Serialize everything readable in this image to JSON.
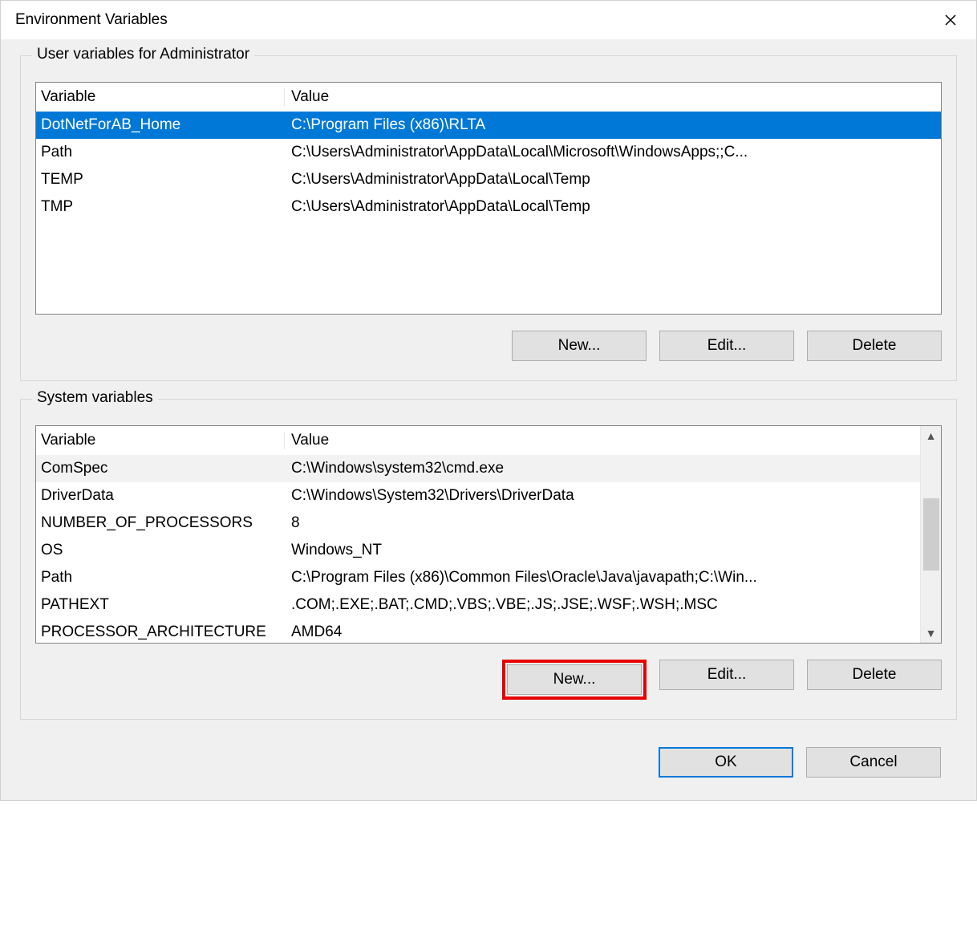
{
  "window": {
    "title": "Environment Variables"
  },
  "group_user": {
    "legend": "User variables for Administrator",
    "col_variable": "Variable",
    "col_value": "Value",
    "rows": [
      {
        "var": "DotNetForAB_Home",
        "val": "C:\\Program Files (x86)\\RLTA",
        "selected": true
      },
      {
        "var": "Path",
        "val": "C:\\Users\\Administrator\\AppData\\Local\\Microsoft\\WindowsApps;;C..."
      },
      {
        "var": "TEMP",
        "val": "C:\\Users\\Administrator\\AppData\\Local\\Temp"
      },
      {
        "var": "TMP",
        "val": "C:\\Users\\Administrator\\AppData\\Local\\Temp"
      }
    ],
    "btn_new": "New...",
    "btn_edit": "Edit...",
    "btn_delete": "Delete"
  },
  "group_system": {
    "legend": "System variables",
    "col_variable": "Variable",
    "col_value": "Value",
    "rows": [
      {
        "var": "ComSpec",
        "val": "C:\\Windows\\system32\\cmd.exe",
        "alt": true
      },
      {
        "var": "DriverData",
        "val": "C:\\Windows\\System32\\Drivers\\DriverData"
      },
      {
        "var": "NUMBER_OF_PROCESSORS",
        "val": "8"
      },
      {
        "var": "OS",
        "val": "Windows_NT"
      },
      {
        "var": "Path",
        "val": "C:\\Program Files (x86)\\Common Files\\Oracle\\Java\\javapath;C:\\Win..."
      },
      {
        "var": "PATHEXT",
        "val": ".COM;.EXE;.BAT;.CMD;.VBS;.VBE;.JS;.JSE;.WSF;.WSH;.MSC"
      },
      {
        "var": "PROCESSOR_ARCHITECTURE",
        "val": "AMD64"
      }
    ],
    "btn_new": "New...",
    "btn_edit": "Edit...",
    "btn_delete": "Delete"
  },
  "dialog": {
    "btn_ok": "OK",
    "btn_cancel": "Cancel"
  }
}
